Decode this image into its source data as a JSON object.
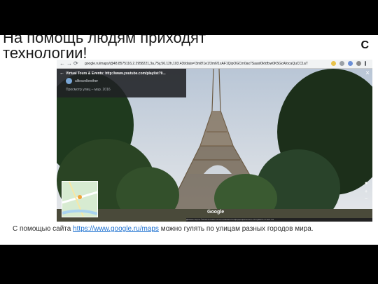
{
  "slide": {
    "title": "На помощь людям приходят технологии!",
    "corner_letter": "С",
    "caption_before": "С помощью сайта ",
    "caption_link": "https://www.google.ru/maps",
    "caption_after": " можно гулять по улицам разных городов мира."
  },
  "browser": {
    "url": "google.ru/maps/@48.8575116,2.2958221,3a,75y,56.12h,103.43t/data=!3m8!1e1!3m6!1sAF1QipOGCm0ax7Saaxl0kfdfxw0K5GcAfocaQuCC1aT",
    "nav_back": "←",
    "nav_forward": "→",
    "nav_reload": "⟳",
    "card": {
      "title": "Virtual Tours & Events: http://www.youtube.com/playlist?li...",
      "author": "alltravelbrother",
      "date": "Просмотр улиц – мар. 2016"
    },
    "google_logo": "Google",
    "footer_text": "Данные карты ©2019   Условия использования   Конфиденциальность   Отправить отзыв   1 м"
  },
  "colors": {
    "link": "#1a6fd0",
    "card_bg": "#202124",
    "sky": "#cfd8e2"
  }
}
